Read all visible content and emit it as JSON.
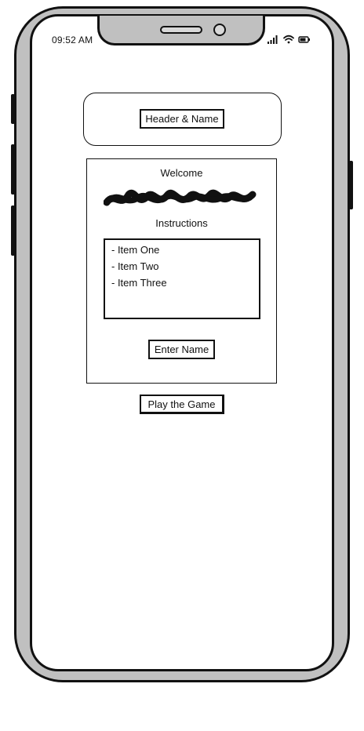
{
  "status_bar": {
    "time": "09:52 AM",
    "icons": [
      "signal-icon",
      "wifi-icon",
      "battery-icon"
    ]
  },
  "header": {
    "label": "Header & Name"
  },
  "welcome": {
    "title": "Welcome",
    "scribble": "redacted-name-scribble"
  },
  "instructions": {
    "title": "Instructions",
    "items": [
      "- Item One",
      "- Item Two",
      "- Item Three"
    ]
  },
  "buttons": {
    "enter_name": "Enter Name",
    "play": "Play the Game"
  },
  "colors": {
    "frame": "#c0c0c0",
    "ink": "#111111",
    "screen": "#ffffff"
  }
}
